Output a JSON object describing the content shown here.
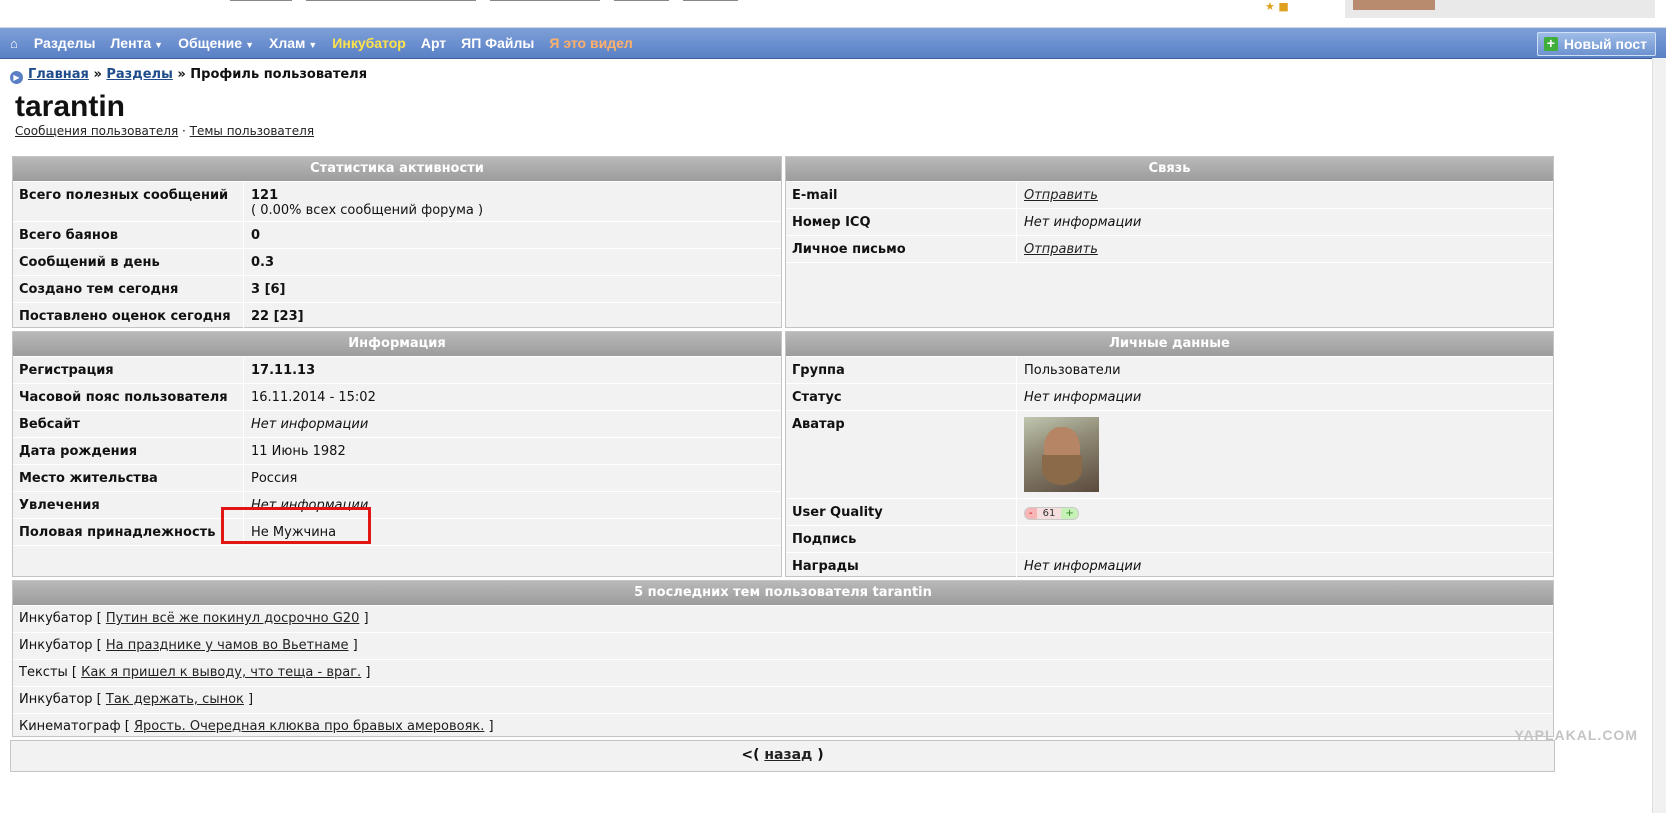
{
  "nav": {
    "home_icon": "home-icon",
    "items": [
      {
        "label": "Разделы",
        "caret": false
      },
      {
        "label": "Лента",
        "caret": true
      },
      {
        "label": "Общение",
        "caret": true
      },
      {
        "label": "Хлам",
        "caret": true
      },
      {
        "label": "Инкубатор",
        "caret": false,
        "color": "#ffe34a"
      },
      {
        "label": "Арт",
        "caret": false
      },
      {
        "label": "ЯП Файлы",
        "caret": false
      },
      {
        "label": "Я это видел",
        "caret": false,
        "color": "#ffb06a"
      }
    ],
    "new_post": "Новый пост"
  },
  "breadcrumb": {
    "home": "Главная",
    "sep": "»",
    "sections": "Разделы",
    "current": "Профиль пользователя"
  },
  "user": {
    "name": "tarantin",
    "link_posts": "Сообщения пользователя",
    "link_sep": "·",
    "link_topics": "Темы пользователя"
  },
  "stats": {
    "title": "Статистика активности",
    "rows": [
      {
        "k": "Всего полезных сообщений",
        "v": "121",
        "v2": "( 0.00% всех сообщений форума )"
      },
      {
        "k": "Всего баянов",
        "v": "0"
      },
      {
        "k": "Сообщений в день",
        "v": "0.3"
      },
      {
        "k": "Создано тем сегодня",
        "v": "3 [6]"
      },
      {
        "k": "Поставлено оценок сегодня",
        "v": "22 [23]"
      }
    ]
  },
  "contact": {
    "title": "Связь",
    "rows": [
      {
        "k": "E-mail",
        "v": "Отправить"
      },
      {
        "k": "Номер ICQ",
        "v": "Нет информации"
      },
      {
        "k": "Личное письмо",
        "v": "Отправить"
      }
    ]
  },
  "info": {
    "title": "Информация",
    "rows": [
      {
        "k": "Регистрация",
        "v": "17.11.13"
      },
      {
        "k": "Часовой пояс пользователя",
        "v": "16.11.2014 - 15:02"
      },
      {
        "k": "Вебсайт",
        "v": "Нет информации"
      },
      {
        "k": "Дата рождения",
        "v": "11 Июнь 1982"
      },
      {
        "k": "Место жительства",
        "v": "Россия"
      },
      {
        "k": "Увлечения",
        "v": "Нет информации"
      },
      {
        "k": "Половая принадлежность",
        "v": "Не Мужчина"
      }
    ]
  },
  "personal": {
    "title": "Личные данные",
    "rows": [
      {
        "k": "Группа",
        "v": "Пользователи"
      },
      {
        "k": "Статус",
        "v": "Нет информации"
      },
      {
        "k": "Аватар",
        "v": ""
      },
      {
        "k": "User Quality",
        "minus": "-",
        "score": "61",
        "plus": "+"
      },
      {
        "k": "Подпись",
        "v": ""
      },
      {
        "k": "Награды",
        "v": "Нет информации"
      }
    ]
  },
  "topics": {
    "title": "5 последних тем пользователя tarantin",
    "items": [
      {
        "section": "Инкубатор",
        "title": "Путин всё же покинул досрочно G20"
      },
      {
        "section": "Инкубатор",
        "title": "На празднике у чамов во Вьетнаме"
      },
      {
        "section": "Тексты",
        "title": "Как я пришел к выводу, что теща - враг."
      },
      {
        "section": "Инкубатор",
        "title": "Так держать, сынок"
      },
      {
        "section": "Кинематограф",
        "title": "Ярость. Очередная клюква про бравых амеровояк."
      }
    ]
  },
  "back": {
    "prefix": "<(",
    "label": "назад",
    "suffix": ")"
  },
  "watermark": "YAPLAKAL.COM"
}
